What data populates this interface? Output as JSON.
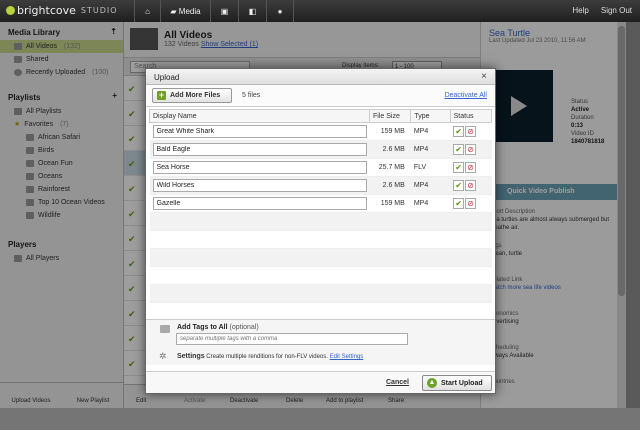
{
  "topbar": {
    "brand": "brightcove",
    "brand_suffix": "STUDIO",
    "nav": [
      {
        "label": "",
        "icon": "home-icon"
      },
      {
        "label": "Media",
        "icon": "folder-icon"
      },
      {
        "label": "",
        "icon": "player-icon"
      },
      {
        "label": "",
        "icon": "publish-icon"
      },
      {
        "label": "",
        "icon": "chat-icon"
      }
    ],
    "help": "Help",
    "signout": "Sign Out"
  },
  "sidebar": {
    "media_library": "Media Library",
    "media_items": [
      {
        "label": "All Videos",
        "count": "(132)"
      },
      {
        "label": "Shared",
        "count": ""
      },
      {
        "label": "Recently Uploaded",
        "count": "(100)"
      }
    ],
    "playlists": "Playlists",
    "playlist_items": [
      {
        "label": "All Playlists",
        "count": ""
      },
      {
        "label": "Favorites",
        "count": "(7)"
      }
    ],
    "favorites": [
      "African Safari",
      "Birds",
      "Ocean Fun",
      "Oceans",
      "Rainforest",
      "Top 10 Ocean Videos",
      "Wildlife"
    ],
    "players": "Players",
    "player_items": [
      {
        "label": "All Players"
      }
    ],
    "upload_videos": "Upload Videos",
    "new_playlist": "New Playlist"
  },
  "main": {
    "title": "All Videos",
    "subtitle": "132 Videos",
    "show_selected": "Show Selected (1)",
    "search_placeholder": "Search",
    "display_items_label": "Display items:",
    "display_items_value": "1 - 100"
  },
  "detail": {
    "title": "Sea Turtle",
    "updated": "Last Updated Jul 23 2010, 11:56 AM",
    "status_label": "Status",
    "status_value": "Active",
    "duration_label": "Duration",
    "duration_value": "0:13",
    "video_id_label": "Video ID",
    "video_id_value": "1840781818",
    "quick_publish": "Quick Video Publish",
    "short_desc_label": "Short Description",
    "short_desc_value": "Sea turtles are almost always submerged but breathe air.",
    "tags_label": "Tags",
    "tags_value": "ocean, turtle",
    "related_label": "Related Link",
    "related_value": "Watch more sea life videos",
    "economics_label": "Economics",
    "economics_value": "Advertising",
    "scheduling_label": "Scheduling",
    "scheduling_value": "Always Available",
    "countries_label": "Countries"
  },
  "actions": [
    "Edit",
    "Activate",
    "Deactivate",
    "Delete",
    "Add to playlist",
    "Share"
  ],
  "modal": {
    "title": "Upload",
    "close": "×",
    "add_files": "Add More Files",
    "file_count": "5 files",
    "deactivate_all": "Deactivate All",
    "columns": {
      "name": "Display Name",
      "size": "File Size",
      "type": "Type",
      "status": "Status"
    },
    "files": [
      {
        "name": "Great White Shark",
        "size": "159 MB",
        "type": "MP4"
      },
      {
        "name": "Bald Eagle",
        "size": "2.6 MB",
        "type": "MP4"
      },
      {
        "name": "Sea Horse",
        "size": "25.7 MB",
        "type": "FLV"
      },
      {
        "name": "Wild Horses",
        "size": "2.6 MB",
        "type": "MP4"
      },
      {
        "name": "Gazelle",
        "size": "159 MB",
        "type": "MP4"
      }
    ],
    "tags_label": "Add Tags to All",
    "tags_optional": "(optional)",
    "tags_placeholder": "separate multiple tags with a comma",
    "settings_label": "Settings",
    "settings_text": "Create multiple renditions for non-FLV videos.",
    "edit_settings": "Edit Settings",
    "cancel": "Cancel",
    "start_upload": "Start Upload"
  }
}
